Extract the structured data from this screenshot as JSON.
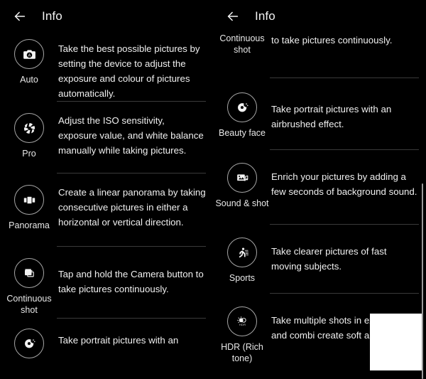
{
  "screens": [
    {
      "appbar": {
        "back_icon": "arrow-left-icon",
        "title": "Info"
      },
      "rows": [
        {
          "icon": "camera-auto-icon",
          "label": "Auto",
          "description": "Take the best possible pictures by setting the device to adjust the exposure and colour of pictures automatically."
        },
        {
          "icon": "aperture-icon",
          "label": "Pro",
          "description": "Adjust the ISO sensitivity, exposure value, and white balance manually while taking pictures."
        },
        {
          "icon": "panorama-icon",
          "label": "Panorama",
          "description": "Create a linear panorama by taking consecutive pictures in either a horizontal or vertical direction."
        },
        {
          "icon": "burst-shot-icon",
          "label": "Continuous shot",
          "description": "Tap and hold the Camera button to take pictures continuously."
        },
        {
          "icon": "beauty-face-icon",
          "label": "",
          "description": "Take portrait pictures with an"
        }
      ]
    },
    {
      "appbar": {
        "back_icon": "arrow-left-icon",
        "title": "Info"
      },
      "rows": [
        {
          "icon": "",
          "label": "Continuous shot",
          "description": "to take pictures continuously."
        },
        {
          "icon": "beauty-face-icon",
          "label": "Beauty face",
          "description": "Take portrait pictures with an airbrushed effect."
        },
        {
          "icon": "sound-shot-icon",
          "label": "Sound & shot",
          "description": "Enrich your pictures by adding a few seconds of background sound."
        },
        {
          "icon": "sports-icon",
          "label": "Sports",
          "description": "Take clearer pictures of fast moving subjects."
        },
        {
          "icon": "hdr-icon",
          "label": "HDR (Rich tone)",
          "description": "Take multiple shots in exposures and combi create soft and rich c"
        }
      ]
    }
  ],
  "colors": {
    "background": "#000000",
    "text": "#f0f0f0",
    "divider": "#3a3a3a",
    "icon_outline": "#a6a6a6",
    "scrollbar": "#9a9a9a",
    "occluder": "#ffffff"
  }
}
